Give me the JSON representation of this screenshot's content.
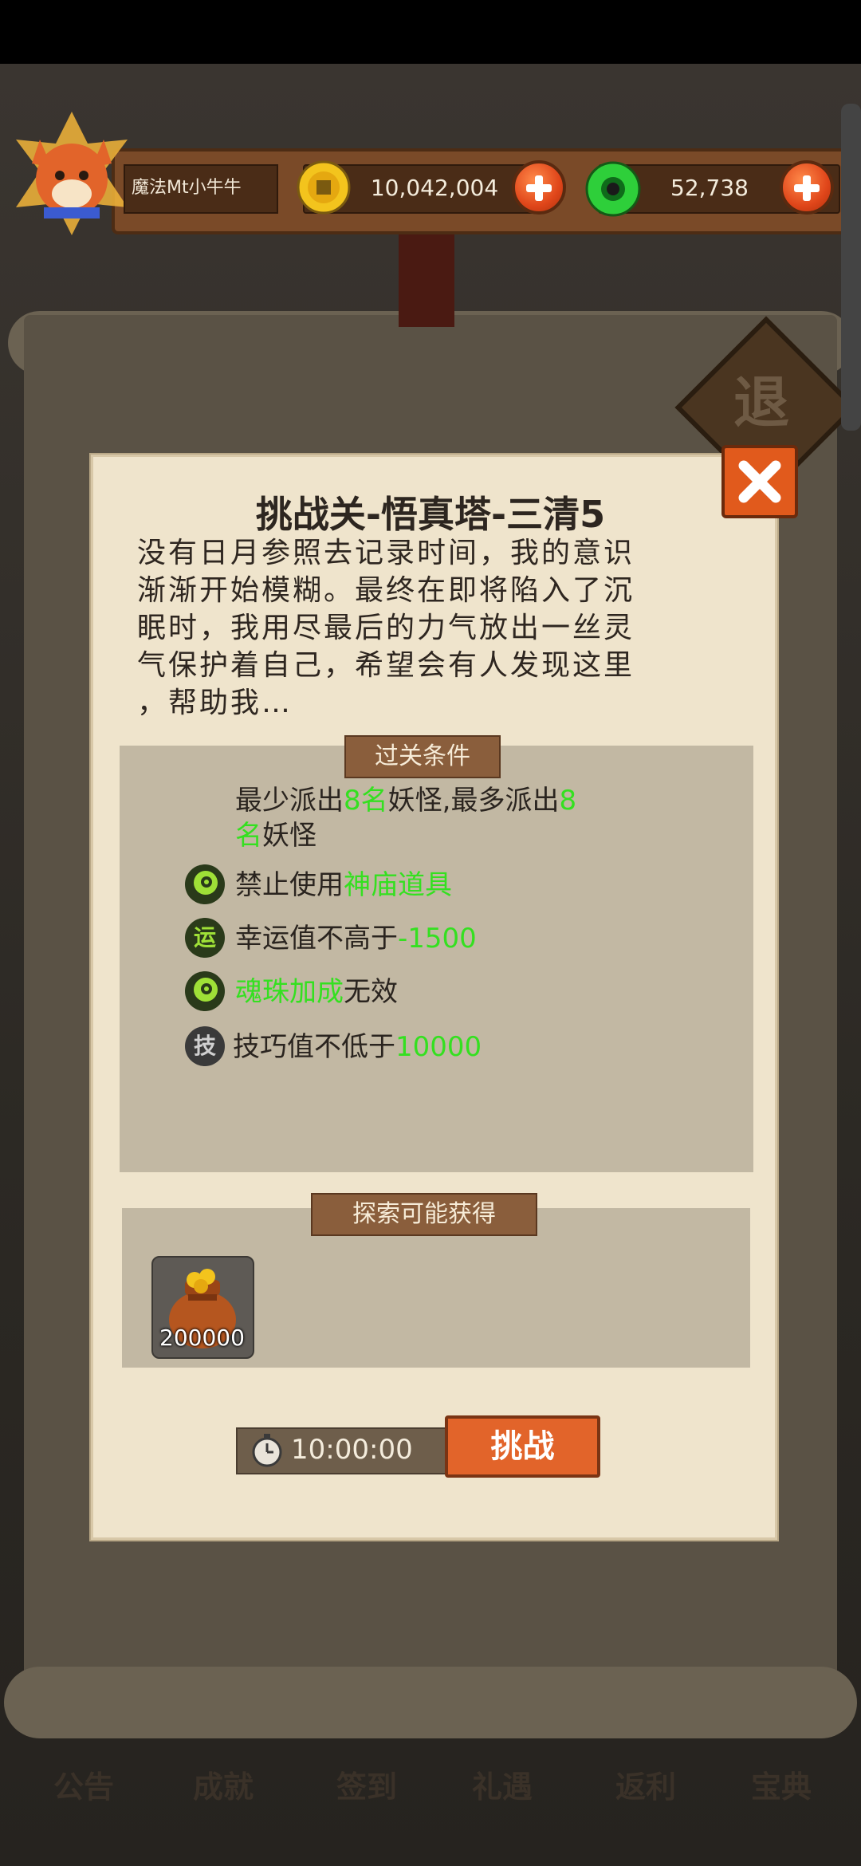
{
  "header": {
    "player_name": "魔法Mt小牛牛",
    "coins": "10,042,004",
    "jade": "52,738"
  },
  "background": {
    "exit_label": "退",
    "nav": [
      "公告",
      "成就",
      "签到",
      "礼遇",
      "返利",
      "宝典"
    ]
  },
  "modal": {
    "title": "挑战关-悟真塔-三清5",
    "story_lines": [
      "没有日月参照去记录时间，我的意识",
      "渐渐开始模糊。最终在即将陷入了沉",
      "眠时，我用尽最后的力气放出一丝灵",
      "气保护着自己，希望会有人发现这里",
      "，帮助我…"
    ],
    "conditions_tab": "过关条件",
    "conditions": {
      "dispatch_a": "最少派出",
      "dispatch_min": "8名",
      "dispatch_b": "妖怪,最多派出",
      "dispatch_max_num": "8",
      "dispatch_max_unit": "名",
      "dispatch_c": "妖怪",
      "rule1_prefix": "禁止使用",
      "rule1_highlight": "神庙道具",
      "rule2_icon": "运",
      "rule2_prefix": "幸运值不高于",
      "rule2_highlight": "-1500",
      "rule3_highlight": "魂珠加成",
      "rule3_suffix": "无效",
      "rule4_icon": "技",
      "rule4_prefix": "技巧值不低于",
      "rule4_highlight": "10000"
    },
    "rewards_tab": "探索可能获得",
    "reward_quantity": "200000",
    "timer": "10:00:00",
    "challenge_label": "挑战"
  },
  "colors": {
    "highlight": "#34e020",
    "accent_orange": "#e2642a",
    "panel_bg": "#c2b8a3",
    "modal_bg": "#efe4cc"
  }
}
